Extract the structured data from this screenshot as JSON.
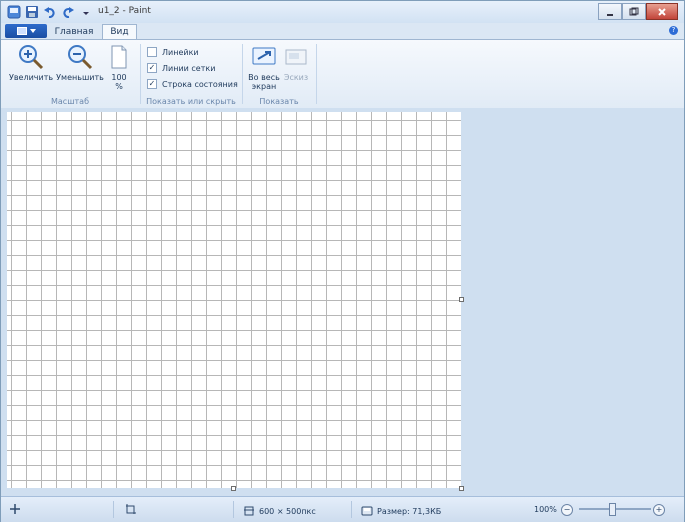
{
  "window": {
    "title": "u1_2 - Paint"
  },
  "quick_access": {
    "icons": [
      "save-icon",
      "undo-icon",
      "redo-icon",
      "customize-arrow-icon"
    ]
  },
  "tabs": [
    {
      "label": "Главная"
    },
    {
      "label": "Вид"
    }
  ],
  "ribbon": {
    "zoom_group": {
      "label": "Масштаб",
      "zoom_in": "Увеличить",
      "zoom_out": "Уменьшить",
      "zoom_100": "100\n%"
    },
    "show_group": {
      "label": "Показать или скрыть",
      "rulers": {
        "label": "Линейки",
        "checked": false
      },
      "gridlines": {
        "label": "Линии сетки",
        "checked": true
      },
      "statusbar": {
        "label": "Строка состояния",
        "checked": true
      }
    },
    "display_group": {
      "label": "Показать",
      "fullscreen": "Во весь\nэкран",
      "thumbnail": "Эскиз"
    }
  },
  "status": {
    "dimensions": "600 × 500пкс",
    "size": "Размер: 71,3КБ",
    "zoom": "100%"
  },
  "colors": {
    "accent": "#1a4ea3",
    "ribbon": "#e1ebf6",
    "workspace": "#cfdff0"
  }
}
